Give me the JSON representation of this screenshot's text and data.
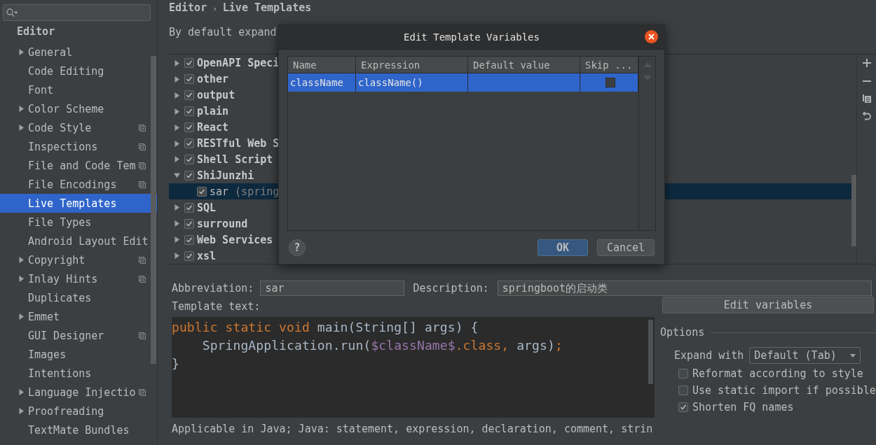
{
  "sidebar": {
    "section": "Editor",
    "items": [
      {
        "label": "General",
        "kind": "group",
        "project_level": false,
        "selected": false
      },
      {
        "label": "Code Editing",
        "kind": "page",
        "project_level": false,
        "selected": false
      },
      {
        "label": "Font",
        "kind": "page",
        "project_level": false,
        "selected": false
      },
      {
        "label": "Color Scheme",
        "kind": "group",
        "project_level": false,
        "selected": false
      },
      {
        "label": "Code Style",
        "kind": "group",
        "project_level": true,
        "selected": false
      },
      {
        "label": "Inspections",
        "kind": "page",
        "project_level": true,
        "selected": false
      },
      {
        "label": "File and Code Tem",
        "kind": "page",
        "project_level": true,
        "selected": false
      },
      {
        "label": "File Encodings",
        "kind": "page",
        "project_level": true,
        "selected": false
      },
      {
        "label": "Live Templates",
        "kind": "page",
        "project_level": false,
        "selected": true
      },
      {
        "label": "File Types",
        "kind": "page",
        "project_level": false,
        "selected": false
      },
      {
        "label": "Android Layout Edit",
        "kind": "page",
        "project_level": false,
        "selected": false
      },
      {
        "label": "Copyright",
        "kind": "group",
        "project_level": true,
        "selected": false
      },
      {
        "label": "Inlay Hints",
        "kind": "group",
        "project_level": true,
        "selected": false
      },
      {
        "label": "Duplicates",
        "kind": "page",
        "project_level": false,
        "selected": false
      },
      {
        "label": "Emmet",
        "kind": "group",
        "project_level": false,
        "selected": false
      },
      {
        "label": "GUI Designer",
        "kind": "page",
        "project_level": true,
        "selected": false
      },
      {
        "label": "Images",
        "kind": "page",
        "project_level": false,
        "selected": false
      },
      {
        "label": "Intentions",
        "kind": "page",
        "project_level": false,
        "selected": false
      },
      {
        "label": "Language Injectio",
        "kind": "group",
        "project_level": true,
        "selected": false
      },
      {
        "label": "Proofreading",
        "kind": "group",
        "project_level": false,
        "selected": false
      },
      {
        "label": "TextMate Bundles",
        "kind": "page",
        "project_level": false,
        "selected": false
      }
    ]
  },
  "breadcrumb": [
    "Editor",
    "›",
    "Live Templates"
  ],
  "hint": "By default expand",
  "tree": [
    {
      "label": "OpenAPI Speci",
      "checked": true,
      "expanded": false,
      "selected": false
    },
    {
      "label": "other",
      "checked": true,
      "expanded": false,
      "selected": false
    },
    {
      "label": "output",
      "checked": true,
      "expanded": false,
      "selected": false
    },
    {
      "label": "plain",
      "checked": true,
      "expanded": false,
      "selected": false
    },
    {
      "label": "React",
      "checked": true,
      "expanded": false,
      "selected": false
    },
    {
      "label": "RESTful Web S",
      "checked": true,
      "expanded": false,
      "selected": false
    },
    {
      "label": "Shell Script",
      "checked": true,
      "expanded": false,
      "selected": false
    },
    {
      "label": "ShiJunzhi",
      "checked": true,
      "expanded": true,
      "selected": false,
      "children": [
        {
          "label": "sar",
          "detail": "(spring",
          "checked": true,
          "selected": true
        }
      ]
    },
    {
      "label": "SQL",
      "checked": true,
      "expanded": false,
      "selected": false
    },
    {
      "label": "surround",
      "checked": true,
      "expanded": false,
      "selected": false
    },
    {
      "label": "Web Services",
      "checked": true,
      "expanded": false,
      "selected": false
    },
    {
      "label": "xsl",
      "checked": true,
      "expanded": false,
      "selected": false
    }
  ],
  "abbreviation": {
    "label": "Abbreviation:",
    "value": "sar"
  },
  "description": {
    "label": "Description:",
    "value": "springboot的启动类"
  },
  "template_label": "Template text:",
  "template_code": [
    [
      {
        "text": "public static void",
        "kind": "keyword"
      },
      {
        "text": " main(String[] args) {",
        "kind": "plain"
      }
    ],
    [
      {
        "text": "    SpringApplication.run(",
        "kind": "plain"
      },
      {
        "text": "$className$",
        "kind": "variable"
      },
      {
        "text": ".class,",
        "kind": "keyword"
      },
      {
        "text": " args)",
        "kind": "plain"
      },
      {
        "text": ";",
        "kind": "keyword"
      }
    ],
    [
      {
        "text": "}",
        "kind": "plain"
      }
    ]
  ],
  "applicable": "Applicable in Java; Java: statement, expression, declaration, comment, strin",
  "edit_variables": "Edit variables",
  "options": {
    "title": "Options",
    "expand_label": "Expand with",
    "expand_value": "Default (Tab)",
    "checkboxes": [
      {
        "label": "Reformat according to style",
        "checked": false
      },
      {
        "label": "Use static import if possible",
        "checked": false
      },
      {
        "label": "Shorten FQ names",
        "checked": true
      }
    ]
  },
  "dialog": {
    "title": "Edit Template Variables",
    "columns": [
      "Name",
      "Expression",
      "Default value",
      "Skip ..."
    ],
    "rows": [
      {
        "name": "className",
        "expression": "className()",
        "skip": false,
        "selected": true
      }
    ],
    "help": "?",
    "buttons": [
      {
        "label": "OK",
        "default": true
      },
      {
        "label": "Cancel",
        "default": false
      }
    ]
  }
}
